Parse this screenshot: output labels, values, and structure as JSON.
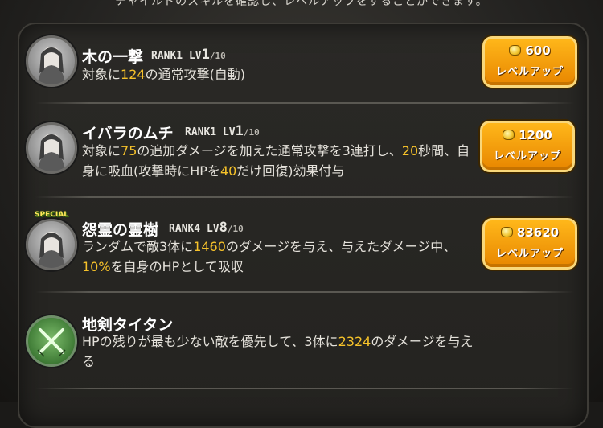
{
  "header": {
    "hint": "チャイルドのスキルを確認し、レベルアップをすることができます。"
  },
  "skills": [
    {
      "name": "木の一撃",
      "rank": "RANK1",
      "lv": "LV",
      "lv_value": "1",
      "lv_max": "/10",
      "desc_parts": [
        "対象に",
        "124",
        "の通常攻撃(自動)"
      ],
      "cost": "600",
      "button": "レベルアップ"
    },
    {
      "name": "イバラのムチ",
      "rank": "RANK1",
      "lv": "LV",
      "lv_value": "1",
      "lv_max": "/10",
      "desc_parts": [
        "対象に",
        "75",
        "の追加ダメージを加えた通常攻撃を3連打し、",
        "20",
        "秒間、自身に吸血(攻撃時にHPを",
        "40",
        "だけ回復)効果付与"
      ],
      "cost": "1200",
      "button": "レベルアップ"
    },
    {
      "name": "怨霊の霊樹",
      "rank": "RANK4",
      "lv": "LV",
      "lv_value": "8",
      "lv_max": "/10",
      "badge": "SPECIAL",
      "desc_parts": [
        "ランダムで敵3体に",
        "1460",
        "のダメージを与え、与えたダメージ中、",
        "10%",
        "を自身のHPとして吸収"
      ],
      "cost": "83620",
      "button": "レベルアップ"
    },
    {
      "name": "地剣タイタン",
      "desc_parts": [
        "HPの残りが最も少ない敵を優先して、3体に",
        "2324",
        "のダメージを与える"
      ]
    }
  ],
  "colors": {
    "highlight": "#f6c22a",
    "button": "#f39a0c"
  },
  "icons": {
    "coin": "coin-icon",
    "swords": "crossed-swords-icon"
  }
}
